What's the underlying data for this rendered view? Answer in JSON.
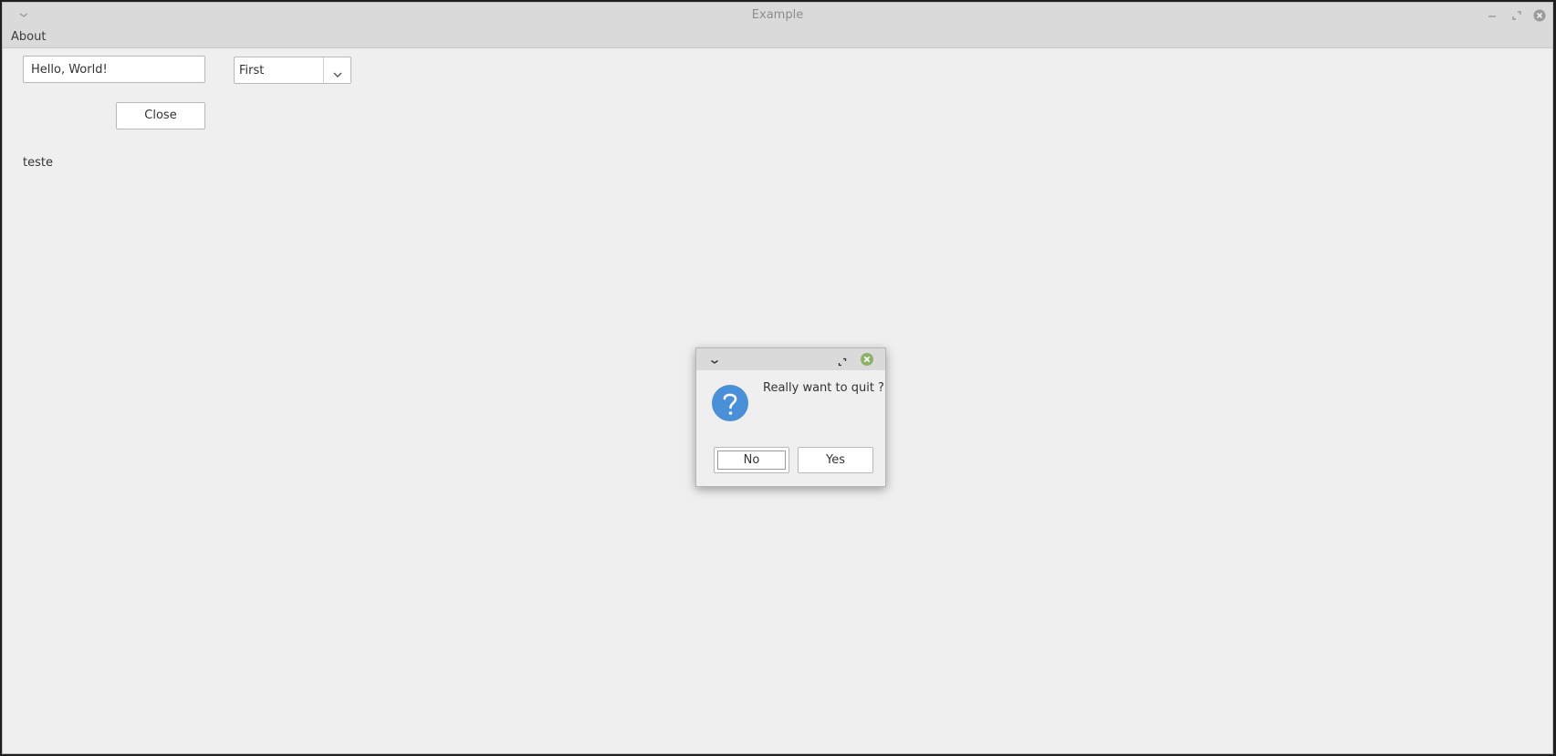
{
  "window": {
    "title": "Example"
  },
  "menubar": {
    "items": [
      {
        "label": "About"
      }
    ]
  },
  "main": {
    "text_input_value": "Hello, World!",
    "combo_selected": "First",
    "close_button_label": "Close",
    "static_label": "teste"
  },
  "dialog": {
    "message": "Really want to quit ?",
    "no_label": "No",
    "yes_label": "Yes",
    "icon": "question-icon"
  },
  "colors": {
    "window_bg": "#efefef",
    "titlebar_bg": "#dadada",
    "dialog_icon": "#4a90d9",
    "dialog_close": "#8cb26a"
  }
}
